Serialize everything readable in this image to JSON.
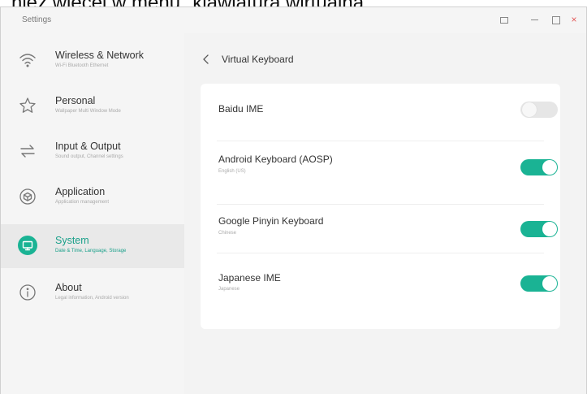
{
  "caption": "nież więcej w menu \"klawiatura wirtualna\".",
  "window": {
    "title": "Settings",
    "controls": {
      "restore_icon": "window-restore-icon",
      "minimize_icon": "minimize-icon",
      "maximize_icon": "maximize-icon",
      "close_icon": "close-icon",
      "close_glyph": "×"
    }
  },
  "sidebar": {
    "items": [
      {
        "label": "Wireless & Network",
        "sub": "Wi-Fi Bluetooth Ethernet",
        "icon": "wifi-icon",
        "active": false
      },
      {
        "label": "Personal",
        "sub": "Wallpaper Multi Window Mode",
        "icon": "star-icon",
        "active": false
      },
      {
        "label": "Input & Output",
        "sub": "Sound output, Channel settings",
        "icon": "swap-arrows-icon",
        "active": false
      },
      {
        "label": "Application",
        "sub": "Application management",
        "icon": "box-icon",
        "active": false
      },
      {
        "label": "System",
        "sub": "Date & Time, Language, Storage",
        "icon": "monitor-icon",
        "active": true
      },
      {
        "label": "About",
        "sub": "Legal information, Android version",
        "icon": "info-icon",
        "active": false
      }
    ]
  },
  "main": {
    "title": "Virtual Keyboard",
    "back_icon": "chevron-left-icon",
    "keyboards": [
      {
        "label": "Baidu IME",
        "sub": "",
        "enabled": false
      },
      {
        "label": "Android Keyboard (AOSP)",
        "sub": "English (US)",
        "enabled": true
      },
      {
        "label": "Google Pinyin Keyboard",
        "sub": "Chinese",
        "enabled": true
      },
      {
        "label": "Japanese IME",
        "sub": "Japanese",
        "enabled": true
      }
    ]
  },
  "colors": {
    "accent": "#1ab394",
    "sidebar_bg": "#f5f5f5",
    "content_bg": "#f3f3f3",
    "toggle_off": "#e6e6e6"
  }
}
